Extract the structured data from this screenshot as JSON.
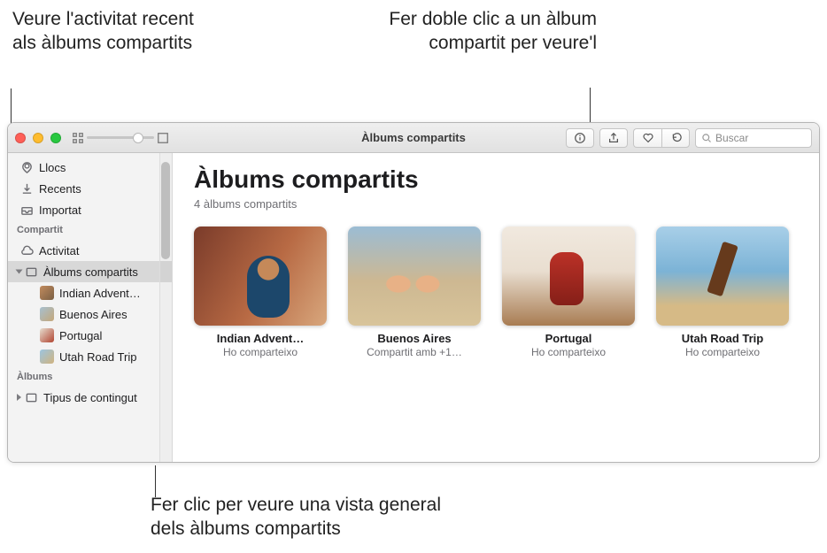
{
  "annotations": {
    "left": "Veure l'activitat recent als àlbums compartits",
    "right": "Fer doble clic a un àlbum compartit per veure'l",
    "bottom": "Fer clic per veure una vista general dels àlbums compartits"
  },
  "window": {
    "title": "Àlbums compartits",
    "search_placeholder": "Buscar"
  },
  "sidebar": {
    "items": [
      {
        "label": "Llocs",
        "icon": "pin"
      },
      {
        "label": "Recents",
        "icon": "download"
      },
      {
        "label": "Importat",
        "icon": "inbox"
      }
    ],
    "shared_heading": "Compartit",
    "activity_label": "Activitat",
    "shared_albums_label": "Àlbums compartits",
    "shared_albums": [
      "Indian Advent…",
      "Buenos Aires",
      "Portugal",
      "Utah Road Trip"
    ],
    "albums_heading": "Àlbums",
    "content_types_label": "Tipus de contingut"
  },
  "main": {
    "title": "Àlbums compartits",
    "subtitle": "4 àlbums compartits",
    "albums": [
      {
        "name": "Indian Advent…",
        "share": "Ho comparteixo"
      },
      {
        "name": "Buenos Aires",
        "share": "Compartit amb +1…"
      },
      {
        "name": "Portugal",
        "share": "Ho comparteixo"
      },
      {
        "name": "Utah Road Trip",
        "share": "Ho comparteixo"
      }
    ]
  }
}
